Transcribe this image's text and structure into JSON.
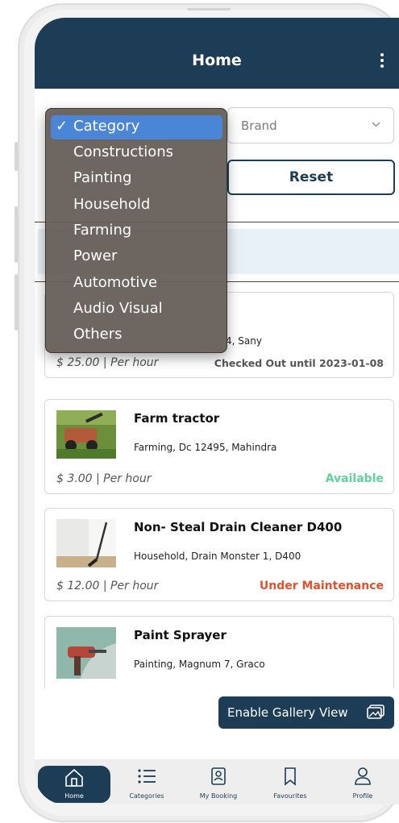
{
  "header": {
    "title": "Home"
  },
  "filters": {
    "category_options": [
      "Category",
      "Constructions",
      "Painting",
      "Household",
      "Farming",
      "Power",
      "Automotive",
      "Audio Visual",
      "Others"
    ],
    "category_selected": "Category",
    "check_mark": "✓",
    "brand_label": "Brand",
    "reset_label": "Reset"
  },
  "items": [
    {
      "title": "",
      "subtitle": "4, Sany",
      "price": "$ 25.00 | Per hour",
      "status": "Checked Out until 2023-01-08",
      "status_color": "#444444"
    },
    {
      "title": "Farm tractor",
      "subtitle": "Farming, Dc 12495, Mahindra",
      "price": "$ 3.00 | Per hour",
      "status": "Available",
      "status_color": "#5fd39b"
    },
    {
      "title": "Non- Steal Drain Cleaner D400",
      "subtitle": "Household, Drain Monster 1, D400",
      "price": "$ 12.00 | Per hour",
      "status": "Under Maintenance",
      "status_color": "#e3502b"
    },
    {
      "title": "Paint Sprayer",
      "subtitle": "Painting, Magnum 7, Graco",
      "price": "",
      "status": ""
    }
  ],
  "gallery_button": {
    "label": "Enable Gallery View"
  },
  "bottom_nav": [
    {
      "label": "Home",
      "icon": "home-icon",
      "active": true
    },
    {
      "label": "Categories",
      "icon": "list-icon",
      "active": false
    },
    {
      "label": "My Booking",
      "icon": "booking-icon",
      "active": false
    },
    {
      "label": "Favourites",
      "icon": "bookmark-icon",
      "active": false
    },
    {
      "label": "Profile",
      "icon": "profile-icon",
      "active": false
    }
  ],
  "colors": {
    "primary": "#1c3d55",
    "available": "#5fd39b",
    "maintenance": "#e3502b",
    "selected_option": "#4b86d6"
  }
}
